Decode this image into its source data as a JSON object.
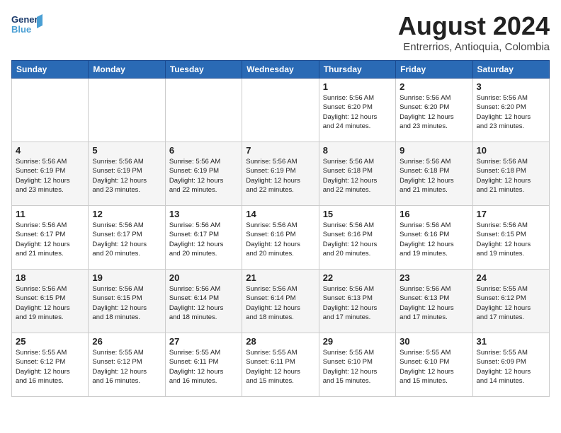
{
  "logo": {
    "line1": "General",
    "line2": "Blue"
  },
  "title": "August 2024",
  "location": "Entrerrios, Antioquia, Colombia",
  "days_of_week": [
    "Sunday",
    "Monday",
    "Tuesday",
    "Wednesday",
    "Thursday",
    "Friday",
    "Saturday"
  ],
  "weeks": [
    [
      {
        "day": "",
        "info": ""
      },
      {
        "day": "",
        "info": ""
      },
      {
        "day": "",
        "info": ""
      },
      {
        "day": "",
        "info": ""
      },
      {
        "day": "1",
        "info": "Sunrise: 5:56 AM\nSunset: 6:20 PM\nDaylight: 12 hours\nand 24 minutes."
      },
      {
        "day": "2",
        "info": "Sunrise: 5:56 AM\nSunset: 6:20 PM\nDaylight: 12 hours\nand 23 minutes."
      },
      {
        "day": "3",
        "info": "Sunrise: 5:56 AM\nSunset: 6:20 PM\nDaylight: 12 hours\nand 23 minutes."
      }
    ],
    [
      {
        "day": "4",
        "info": "Sunrise: 5:56 AM\nSunset: 6:19 PM\nDaylight: 12 hours\nand 23 minutes."
      },
      {
        "day": "5",
        "info": "Sunrise: 5:56 AM\nSunset: 6:19 PM\nDaylight: 12 hours\nand 23 minutes."
      },
      {
        "day": "6",
        "info": "Sunrise: 5:56 AM\nSunset: 6:19 PM\nDaylight: 12 hours\nand 22 minutes."
      },
      {
        "day": "7",
        "info": "Sunrise: 5:56 AM\nSunset: 6:19 PM\nDaylight: 12 hours\nand 22 minutes."
      },
      {
        "day": "8",
        "info": "Sunrise: 5:56 AM\nSunset: 6:18 PM\nDaylight: 12 hours\nand 22 minutes."
      },
      {
        "day": "9",
        "info": "Sunrise: 5:56 AM\nSunset: 6:18 PM\nDaylight: 12 hours\nand 21 minutes."
      },
      {
        "day": "10",
        "info": "Sunrise: 5:56 AM\nSunset: 6:18 PM\nDaylight: 12 hours\nand 21 minutes."
      }
    ],
    [
      {
        "day": "11",
        "info": "Sunrise: 5:56 AM\nSunset: 6:17 PM\nDaylight: 12 hours\nand 21 minutes."
      },
      {
        "day": "12",
        "info": "Sunrise: 5:56 AM\nSunset: 6:17 PM\nDaylight: 12 hours\nand 20 minutes."
      },
      {
        "day": "13",
        "info": "Sunrise: 5:56 AM\nSunset: 6:17 PM\nDaylight: 12 hours\nand 20 minutes."
      },
      {
        "day": "14",
        "info": "Sunrise: 5:56 AM\nSunset: 6:16 PM\nDaylight: 12 hours\nand 20 minutes."
      },
      {
        "day": "15",
        "info": "Sunrise: 5:56 AM\nSunset: 6:16 PM\nDaylight: 12 hours\nand 20 minutes."
      },
      {
        "day": "16",
        "info": "Sunrise: 5:56 AM\nSunset: 6:16 PM\nDaylight: 12 hours\nand 19 minutes."
      },
      {
        "day": "17",
        "info": "Sunrise: 5:56 AM\nSunset: 6:15 PM\nDaylight: 12 hours\nand 19 minutes."
      }
    ],
    [
      {
        "day": "18",
        "info": "Sunrise: 5:56 AM\nSunset: 6:15 PM\nDaylight: 12 hours\nand 19 minutes."
      },
      {
        "day": "19",
        "info": "Sunrise: 5:56 AM\nSunset: 6:15 PM\nDaylight: 12 hours\nand 18 minutes."
      },
      {
        "day": "20",
        "info": "Sunrise: 5:56 AM\nSunset: 6:14 PM\nDaylight: 12 hours\nand 18 minutes."
      },
      {
        "day": "21",
        "info": "Sunrise: 5:56 AM\nSunset: 6:14 PM\nDaylight: 12 hours\nand 18 minutes."
      },
      {
        "day": "22",
        "info": "Sunrise: 5:56 AM\nSunset: 6:13 PM\nDaylight: 12 hours\nand 17 minutes."
      },
      {
        "day": "23",
        "info": "Sunrise: 5:56 AM\nSunset: 6:13 PM\nDaylight: 12 hours\nand 17 minutes."
      },
      {
        "day": "24",
        "info": "Sunrise: 5:55 AM\nSunset: 6:12 PM\nDaylight: 12 hours\nand 17 minutes."
      }
    ],
    [
      {
        "day": "25",
        "info": "Sunrise: 5:55 AM\nSunset: 6:12 PM\nDaylight: 12 hours\nand 16 minutes."
      },
      {
        "day": "26",
        "info": "Sunrise: 5:55 AM\nSunset: 6:12 PM\nDaylight: 12 hours\nand 16 minutes."
      },
      {
        "day": "27",
        "info": "Sunrise: 5:55 AM\nSunset: 6:11 PM\nDaylight: 12 hours\nand 16 minutes."
      },
      {
        "day": "28",
        "info": "Sunrise: 5:55 AM\nSunset: 6:11 PM\nDaylight: 12 hours\nand 15 minutes."
      },
      {
        "day": "29",
        "info": "Sunrise: 5:55 AM\nSunset: 6:10 PM\nDaylight: 12 hours\nand 15 minutes."
      },
      {
        "day": "30",
        "info": "Sunrise: 5:55 AM\nSunset: 6:10 PM\nDaylight: 12 hours\nand 15 minutes."
      },
      {
        "day": "31",
        "info": "Sunrise: 5:55 AM\nSunset: 6:09 PM\nDaylight: 12 hours\nand 14 minutes."
      }
    ]
  ]
}
